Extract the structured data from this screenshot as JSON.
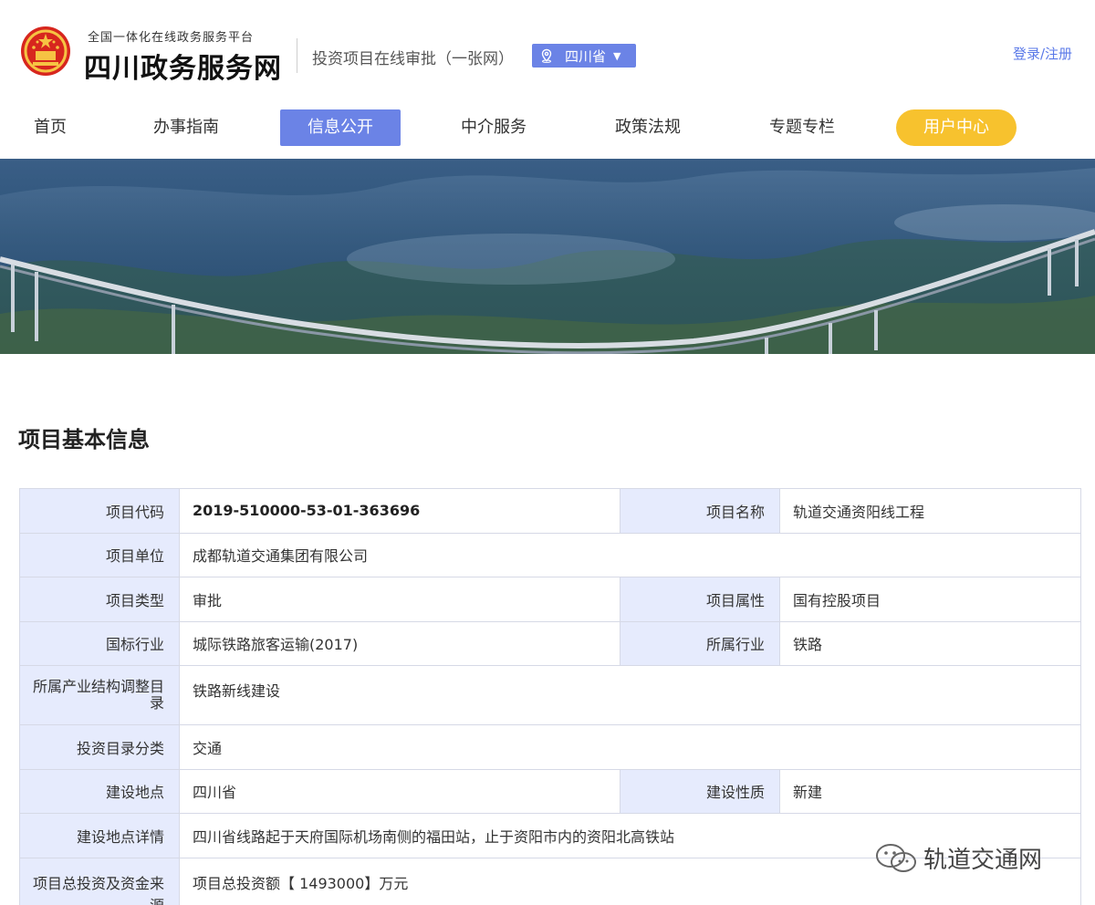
{
  "header": {
    "platform_subtitle": "全国一体化在线政务服务平台",
    "site_title": "四川政务服务网",
    "portal_name": "投资项目在线审批（一张网）",
    "region": "四川省",
    "login_text": "登录/注册"
  },
  "nav": {
    "items": [
      {
        "label": "首页"
      },
      {
        "label": "办事指南"
      },
      {
        "label": "信息公开"
      },
      {
        "label": "中介服务"
      },
      {
        "label": "政策法规"
      },
      {
        "label": "专题专栏"
      },
      {
        "label": "用户中心"
      }
    ],
    "active_index": 2
  },
  "section": {
    "title": "项目基本信息"
  },
  "info": {
    "project_code_label": "项目代码",
    "project_code": "2019-510000-53-01-363696",
    "project_name_label": "项目名称",
    "project_name": "轨道交通资阳线工程",
    "unit_label": "项目单位",
    "unit": "成都轨道交通集团有限公司",
    "type_label": "项目类型",
    "type": "审批",
    "attribute_label": "项目属性",
    "attribute": "国有控股项目",
    "national_industry_label": "国标行业",
    "national_industry": "城际铁路旅客运输(2017)",
    "industry_label": "所属行业",
    "industry": "铁路",
    "structure_catalog_label": "所属产业结构调整目录",
    "structure_catalog": "铁路新线建设",
    "investment_category_label": "投资目录分类",
    "investment_category": "交通",
    "location_label": "建设地点",
    "location": "四川省",
    "construction_nature_label": "建设性质",
    "construction_nature": "新建",
    "location_detail_label": "建设地点详情",
    "location_detail": "四川省线路起于天府国际机场南侧的福田站，止于资阳市内的资阳北高铁站",
    "total_investment_label": "项目总投资及资金来源",
    "total_investment": "项目总投资额【 1493000】万元"
  },
  "watermark": {
    "text": "轨道交通网"
  },
  "colors": {
    "accent": "#6b83e6",
    "user_center": "#f7c22e",
    "label_bg": "#e6ebfd",
    "link": "#5a79e8"
  }
}
